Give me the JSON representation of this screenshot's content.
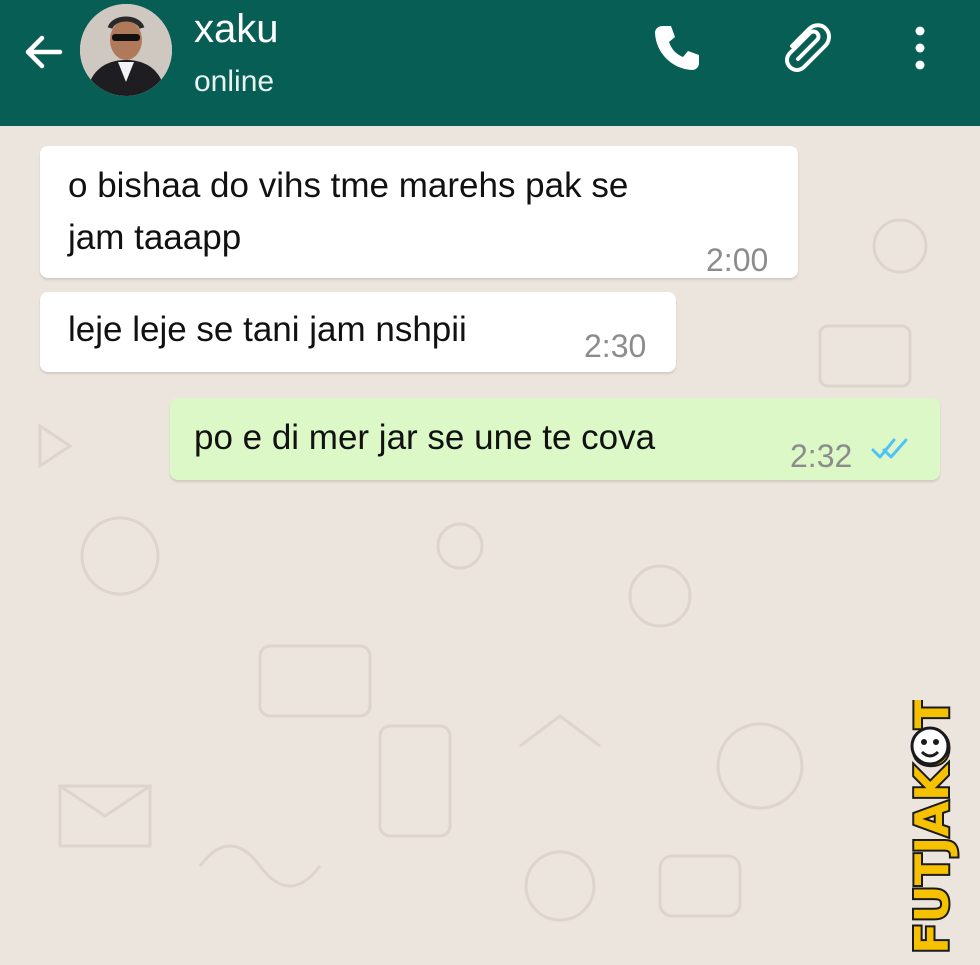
{
  "header": {
    "contact_name": "xaku",
    "status": "online",
    "icons": [
      "back-arrow-icon",
      "phone-icon",
      "paperclip-icon",
      "more-vert-icon"
    ]
  },
  "messages": [
    {
      "direction": "incoming",
      "lines": [
        "o bishaa do vihs tme marehs pak se",
        "jam taaapp"
      ],
      "time": "2:00"
    },
    {
      "direction": "incoming",
      "lines": [
        "leje leje se tani jam nshpii"
      ],
      "time": "2:30"
    },
    {
      "direction": "outgoing",
      "lines": [
        "po e di mer jar se une te cova"
      ],
      "time": "2:32",
      "status": "read"
    }
  ],
  "watermark": {
    "text": "FUTJAKOT"
  },
  "colors": {
    "header": "#075e54",
    "wallpaper": "#ece5dd",
    "incoming_bubble": "#ffffff",
    "outgoing_bubble": "#dcf8c6",
    "read_ticks": "#4fc3f7"
  }
}
